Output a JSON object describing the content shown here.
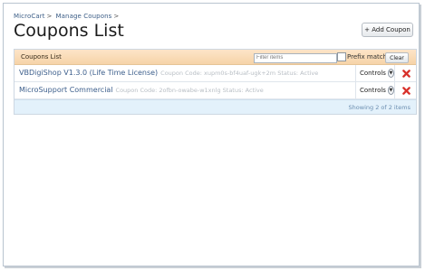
{
  "breadcrumb": [
    "MicroCart",
    "Manage Coupons"
  ],
  "breadcrumb_sep": ">",
  "page_title": "Coupons List",
  "add_button_label": "+ Add Coupon",
  "list": {
    "header_title": "Coupons List",
    "filter_placeholder": "Filter items",
    "prefix_match_label": "Prefix match",
    "prefix_match_checked": false,
    "clear_label": "Clear",
    "rows": [
      {
        "name": "VBDigiShop V1.3.0 (Life Time License)",
        "meta": "Coupon Code: xupm0s-bf4uaf-ugk+2m Status: Active",
        "controls_label": "Controls"
      },
      {
        "name": "MicroSupport Commercial",
        "meta": "Coupon Code: 2ofbn-owabe-w1xnlg Status: Active",
        "controls_label": "Controls"
      }
    ],
    "footer_text": "Showing 2 of 2 items"
  },
  "colors": {
    "header_bg": "#f6d3a8",
    "link": "#3d5f8c",
    "delete_icon": "#d8312b",
    "footer_bg": "#e3f1fb"
  }
}
